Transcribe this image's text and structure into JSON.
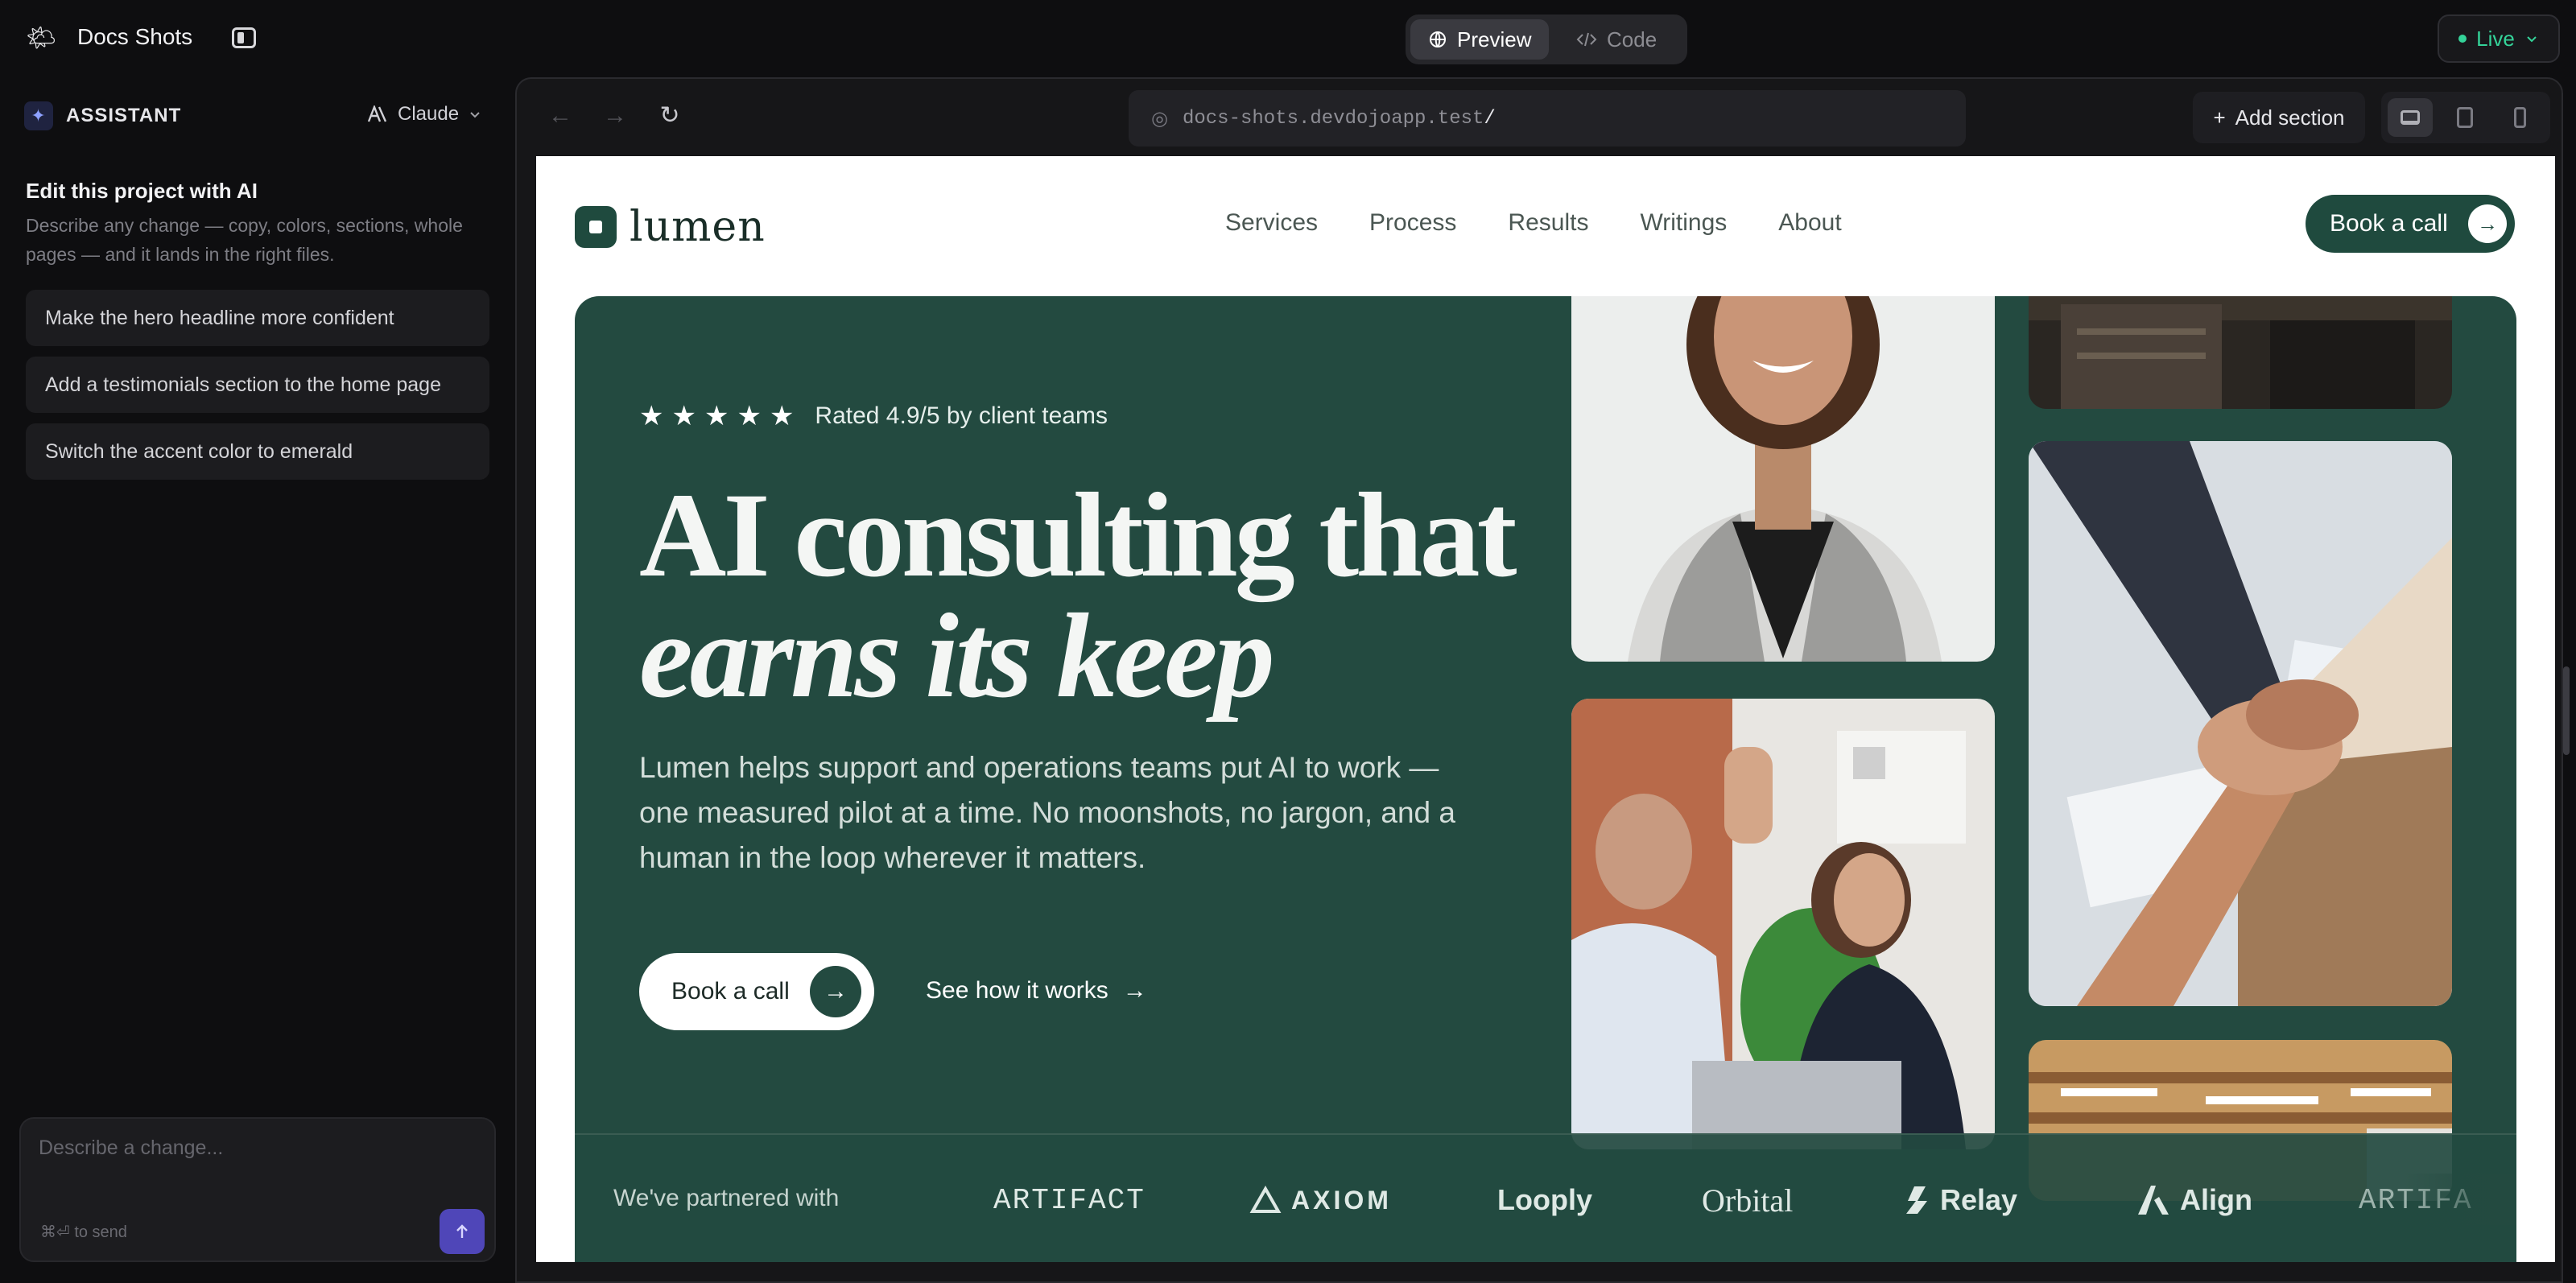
{
  "app": {
    "title": "Docs Shots",
    "logo_icon": "sun-cloud-icon",
    "tabs": [
      {
        "label": "Preview",
        "icon": "globe-icon",
        "active": true
      },
      {
        "label": "Code",
        "icon": "code-icon",
        "active": false
      }
    ],
    "status": {
      "label": "Live",
      "color": "#34d399"
    }
  },
  "assistant": {
    "header": "ASSISTANT",
    "model": "Claude",
    "edit_title": "Edit this project with AI",
    "edit_description": "Describe any change — copy, colors, sections, whole pages — and it lands in the right files.",
    "suggestions": [
      "Make the hero headline more confident",
      "Add a testimonials section to the home page",
      "Switch the accent color to emerald"
    ],
    "composer": {
      "placeholder": "Describe a change...",
      "hint": "⌘⏎ to send",
      "accent": "#4f46b8"
    }
  },
  "browser": {
    "url_host": "docs-shots.devdojoapp.test",
    "url_path": "/",
    "add_section_label": "Add section",
    "devices": [
      "desktop",
      "tablet",
      "mobile"
    ],
    "active_device": "desktop"
  },
  "site": {
    "brand": "lumen",
    "brand_color": "#1f4a3e",
    "nav": [
      "Services",
      "Process",
      "Results",
      "Writings",
      "About"
    ],
    "nav_cta": "Book a call",
    "hero": {
      "rating_stars": 5,
      "rating_text": "Rated 4.9/5 by client teams",
      "headline_line1": "AI consulting that",
      "headline_line2": "earns its keep",
      "lede": "Lumen helps support and operations teams put AI to work — one measured pilot at a time. No moonshots, no jargon, and a human in the loop wherever it matters.",
      "primary_cta": "Book a call",
      "secondary_cta": "See how it works",
      "background": "#234a40"
    },
    "partners": {
      "label": "We've partnered with",
      "logos": [
        "ARTIFACT",
        "AXIOM",
        "Looply",
        "Orbital",
        "Relay",
        "Align",
        "ARTIFA"
      ]
    }
  }
}
